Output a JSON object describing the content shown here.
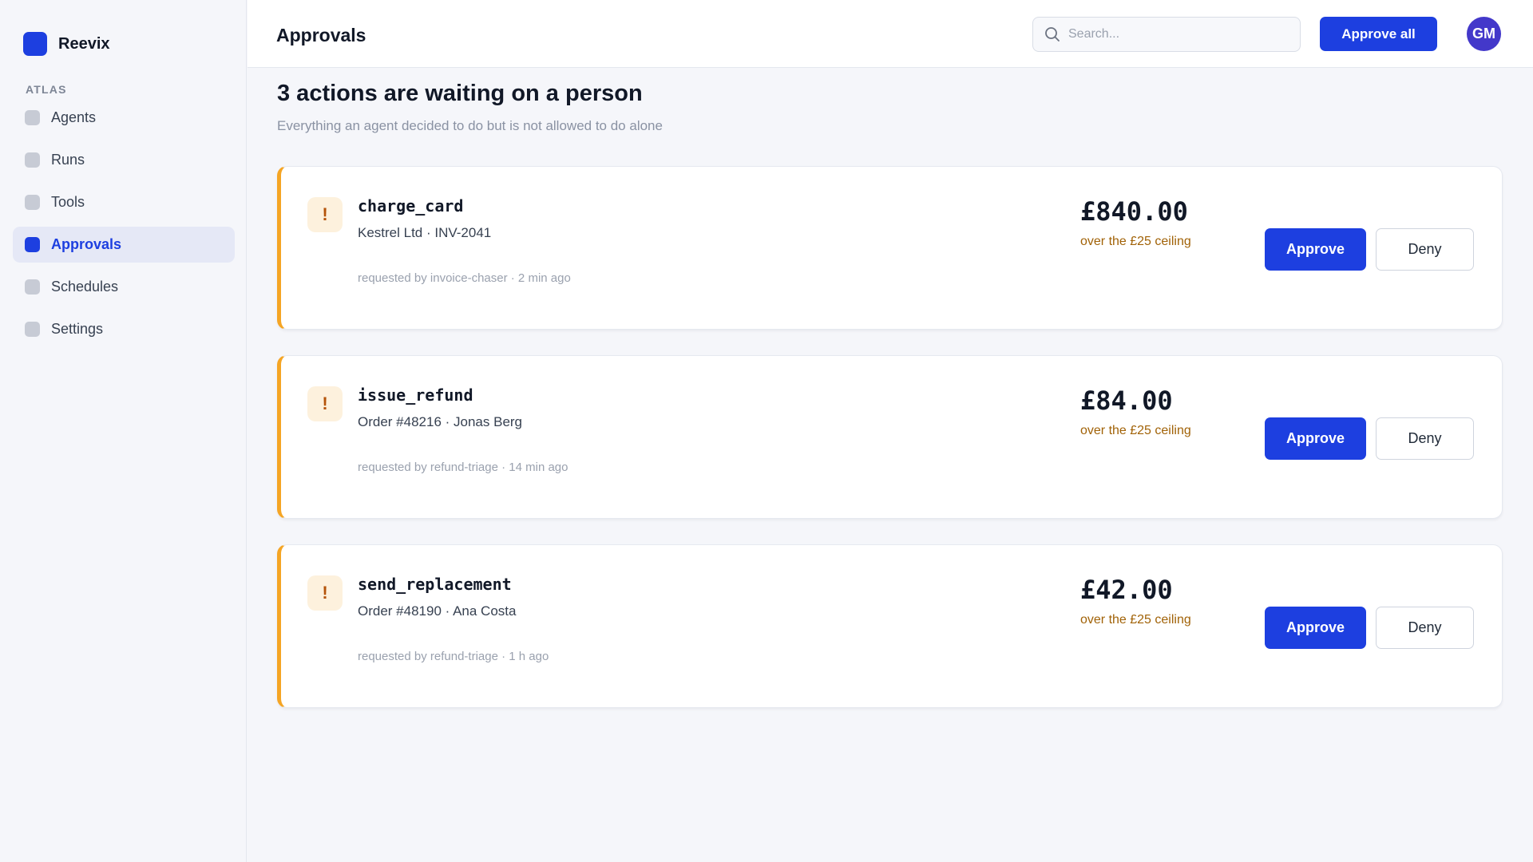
{
  "brand": {
    "name": "Reevix",
    "accent": "#1d3fe0"
  },
  "sidebar": {
    "section": "ATLAS",
    "items": [
      {
        "label": "Agents",
        "active": false
      },
      {
        "label": "Runs",
        "active": false
      },
      {
        "label": "Tools",
        "active": false
      },
      {
        "label": "Approvals",
        "active": true
      },
      {
        "label": "Schedules",
        "active": false
      },
      {
        "label": "Settings",
        "active": false
      }
    ]
  },
  "header": {
    "title": "Approvals",
    "search": {
      "placeholder": "Search...",
      "value": "",
      "icon": "search-icon"
    },
    "approve_all_label": "Approve all",
    "avatar_initials": "GM"
  },
  "main": {
    "headline": "3 actions are waiting on a person",
    "subline": "Everything an agent decided to do but is not allowed to do alone",
    "approvals": [
      {
        "badge": "!",
        "tool": "charge_card",
        "detail": "Kestrel Ltd · INV-2041",
        "requested": "requested by invoice-chaser · 2 min ago",
        "amount": "£840.00",
        "ceiling": "over the £25 ceiling",
        "approve_label": "Approve",
        "deny_label": "Deny"
      },
      {
        "badge": "!",
        "tool": "issue_refund",
        "detail": "Order #48216 · Jonas Berg",
        "requested": "requested by refund-triage · 14 min ago",
        "amount": "£84.00",
        "ceiling": "over the £25 ceiling",
        "approve_label": "Approve",
        "deny_label": "Deny"
      },
      {
        "badge": "!",
        "tool": "send_replacement",
        "detail": "Order #48190 · Ana Costa",
        "requested": "requested by refund-triage · 1 h ago",
        "amount": "£42.00",
        "ceiling": "over the £25 ceiling",
        "approve_label": "Approve",
        "deny_label": "Deny"
      }
    ]
  },
  "colors": {
    "warning_border": "#f5a524",
    "ceiling_text": "#a16207",
    "avatar_bg": "#4338ca"
  }
}
